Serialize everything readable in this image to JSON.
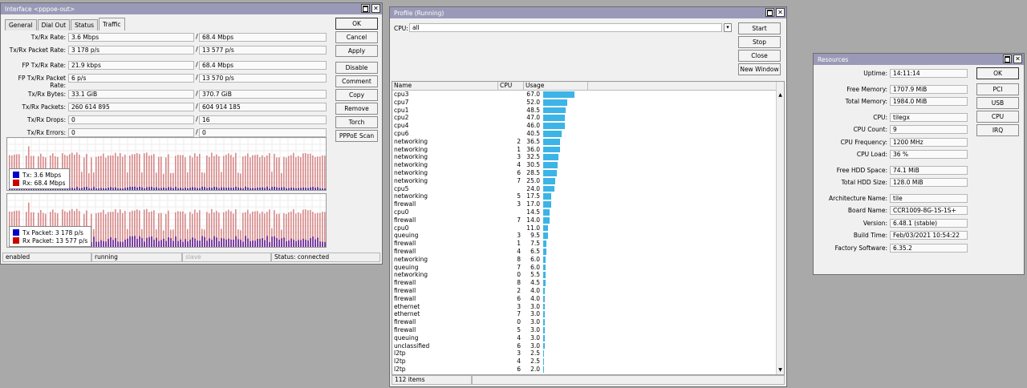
{
  "interface": {
    "title": "Interface <pppoe-out>",
    "tabs": [
      "General",
      "Dial Out",
      "Status",
      "Traffic"
    ],
    "active_tab": "Traffic",
    "rows": [
      {
        "label": "Tx/Rx Rate:",
        "tx": "3.6 Mbps",
        "rx": "68.4 Mbps"
      },
      {
        "label": "Tx/Rx Packet Rate:",
        "tx": "3 178 p/s",
        "rx": "13 577 p/s"
      },
      {
        "label": "FP Tx/Rx Rate:",
        "tx": "21.9 kbps",
        "rx": "68.4 Mbps"
      },
      {
        "label": "FP Tx/Rx Packet Rate:",
        "tx": "6 p/s",
        "rx": "13 570 p/s"
      },
      {
        "label": "Tx/Rx Bytes:",
        "tx": "33.1 GiB",
        "rx": "370.7 GiB"
      },
      {
        "label": "Tx/Rx Packets:",
        "tx": "260 614 895",
        "rx": "604 914 185"
      },
      {
        "label": "Tx/Rx Drops:",
        "tx": "0",
        "rx": "16"
      },
      {
        "label": "Tx/Rx Errors:",
        "tx": "0",
        "rx": "0"
      }
    ],
    "buttons": [
      "OK",
      "Cancel",
      "Apply",
      "Disable",
      "Comment",
      "Copy",
      "Remove",
      "Torch",
      "PPPoE Scan"
    ],
    "legend1": [
      {
        "label": "Tx:",
        "value": "3.6 Mbps",
        "color": "#0000cc"
      },
      {
        "label": "Rx:",
        "value": "68.4 Mbps",
        "color": "#cc0000"
      }
    ],
    "legend2": [
      {
        "label": "Tx Packet:",
        "value": "3 178 p/s",
        "color": "#0000cc"
      },
      {
        "label": "Rx Packet:",
        "value": "13 577 p/s",
        "color": "#cc0000"
      }
    ],
    "status": [
      "enabled",
      "running",
      "slave",
      "Status: connected"
    ]
  },
  "profile": {
    "title": "Profile (Running)",
    "cpu_label": "CPU:",
    "cpu_value": "all",
    "buttons": [
      "Start",
      "Stop",
      "Close",
      "New Window"
    ],
    "columns": [
      "Name",
      "CPU",
      "Usage"
    ],
    "bar_color": "#3cb4e8",
    "rows": [
      {
        "name": "cpu3",
        "cpu": "",
        "usage": "67.0"
      },
      {
        "name": "cpu7",
        "cpu": "",
        "usage": "52.0"
      },
      {
        "name": "cpu1",
        "cpu": "",
        "usage": "48.5"
      },
      {
        "name": "cpu2",
        "cpu": "",
        "usage": "47.0"
      },
      {
        "name": "cpu4",
        "cpu": "",
        "usage": "46.0"
      },
      {
        "name": "cpu6",
        "cpu": "",
        "usage": "40.5"
      },
      {
        "name": "networking",
        "cpu": "2",
        "usage": "36.5"
      },
      {
        "name": "networking",
        "cpu": "1",
        "usage": "36.0"
      },
      {
        "name": "networking",
        "cpu": "3",
        "usage": "32.5"
      },
      {
        "name": "networking",
        "cpu": "4",
        "usage": "30.5"
      },
      {
        "name": "networking",
        "cpu": "6",
        "usage": "28.5"
      },
      {
        "name": "networking",
        "cpu": "7",
        "usage": "25.0"
      },
      {
        "name": "cpu5",
        "cpu": "",
        "usage": "24.0"
      },
      {
        "name": "networking",
        "cpu": "5",
        "usage": "17.5"
      },
      {
        "name": "firewall",
        "cpu": "3",
        "usage": "17.0"
      },
      {
        "name": "cpu0",
        "cpu": "",
        "usage": "14.5"
      },
      {
        "name": "firewall",
        "cpu": "7",
        "usage": "14.0"
      },
      {
        "name": "cpu0",
        "cpu": "",
        "usage": "11.0"
      },
      {
        "name": "queuing",
        "cpu": "3",
        "usage": "9.5"
      },
      {
        "name": "firewall",
        "cpu": "1",
        "usage": "7.5"
      },
      {
        "name": "firewall",
        "cpu": "4",
        "usage": "6.5"
      },
      {
        "name": "networking",
        "cpu": "8",
        "usage": "6.0"
      },
      {
        "name": "queuing",
        "cpu": "7",
        "usage": "6.0"
      },
      {
        "name": "networking",
        "cpu": "0",
        "usage": "5.5"
      },
      {
        "name": "firewall",
        "cpu": "8",
        "usage": "4.5"
      },
      {
        "name": "firewall",
        "cpu": "2",
        "usage": "4.0"
      },
      {
        "name": "firewall",
        "cpu": "6",
        "usage": "4.0"
      },
      {
        "name": "ethernet",
        "cpu": "3",
        "usage": "3.0"
      },
      {
        "name": "ethernet",
        "cpu": "7",
        "usage": "3.0"
      },
      {
        "name": "firewall",
        "cpu": "0",
        "usage": "3.0"
      },
      {
        "name": "firewall",
        "cpu": "5",
        "usage": "3.0"
      },
      {
        "name": "queuing",
        "cpu": "4",
        "usage": "3.0"
      },
      {
        "name": "unclassified",
        "cpu": "6",
        "usage": "3.0"
      },
      {
        "name": "l2tp",
        "cpu": "3",
        "usage": "2.5"
      },
      {
        "name": "l2tp",
        "cpu": "4",
        "usage": "2.5"
      },
      {
        "name": "l2tp",
        "cpu": "6",
        "usage": "2.0"
      }
    ],
    "status": "112 items"
  },
  "resources": {
    "title": "Resources",
    "groups": [
      [
        {
          "label": "Uptime:",
          "value": "14:11:14"
        }
      ],
      [
        {
          "label": "Free Memory:",
          "value": "1707.9 MiB"
        },
        {
          "label": "Total Memory:",
          "value": "1984.0 MiB"
        }
      ],
      [
        {
          "label": "CPU:",
          "value": "tilegx"
        },
        {
          "label": "CPU Count:",
          "value": "9"
        },
        {
          "label": "CPU Frequency:",
          "value": "1200 MHz"
        },
        {
          "label": "CPU Load:",
          "value": "36 %"
        }
      ],
      [
        {
          "label": "Free HDD Space:",
          "value": "74.1 MiB"
        },
        {
          "label": "Total HDD Size:",
          "value": "128.0 MiB"
        }
      ],
      [
        {
          "label": "Architecture Name:",
          "value": "tile"
        },
        {
          "label": "Board Name:",
          "value": "CCR1009-8G-1S-1S+"
        },
        {
          "label": "Version:",
          "value": "6.48.1 (stable)"
        },
        {
          "label": "Build Time:",
          "value": "Feb/03/2021 10:54:22"
        },
        {
          "label": "Factory Software:",
          "value": "6.35.2"
        }
      ]
    ],
    "buttons": [
      "OK",
      "PCI",
      "USB",
      "CPU",
      "IRQ"
    ]
  }
}
